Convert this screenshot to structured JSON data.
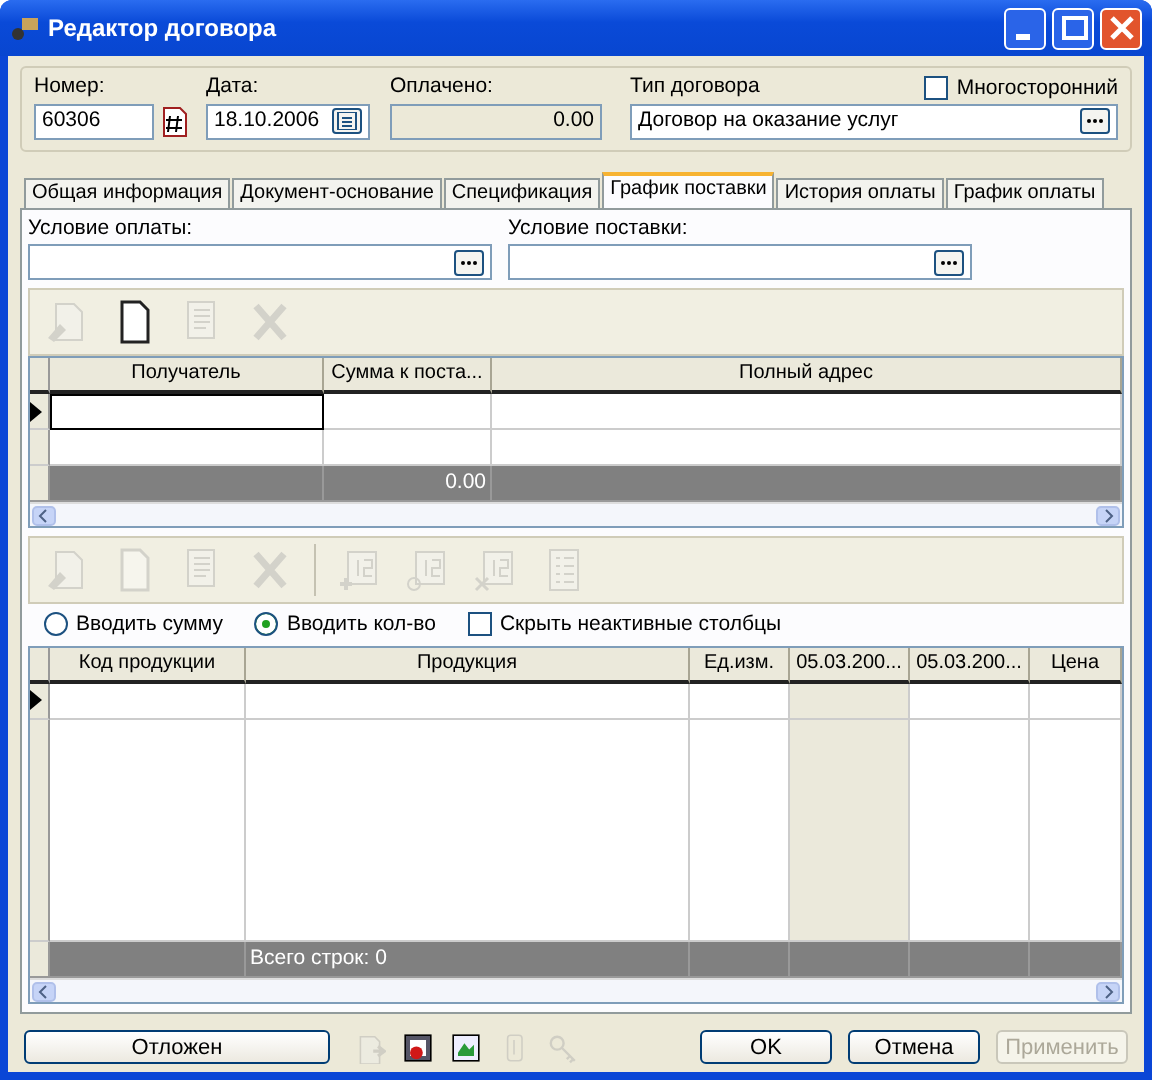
{
  "window": {
    "title": "Редактор договора"
  },
  "header": {
    "number": {
      "label": "Номер:",
      "value": "60306"
    },
    "date": {
      "label": "Дата:",
      "value": "18.10.2006"
    },
    "paid": {
      "label": "Оплачено:",
      "value": "0.00"
    },
    "contract_type": {
      "label": "Тип договора",
      "value": "Договор на оказание услуг"
    },
    "multilateral": {
      "label": "Многосторонний",
      "checked": false
    }
  },
  "tabs": [
    {
      "label": "Общая информация",
      "selected": false
    },
    {
      "label": "Документ-основание",
      "selected": false
    },
    {
      "label": "Спецификация",
      "selected": false
    },
    {
      "label": "График поставки",
      "selected": true
    },
    {
      "label": "История оплаты",
      "selected": false
    },
    {
      "label": "График оплаты",
      "selected": false
    }
  ],
  "conditions": [
    {
      "label": "Условие оплаты:"
    },
    {
      "label": "Условие поставки:"
    }
  ],
  "toolbar_1": [
    {
      "kind": "edit",
      "disabled": true
    },
    {
      "kind": "new",
      "disabled": false
    },
    {
      "kind": "copy",
      "disabled": true
    },
    {
      "kind": "delete",
      "disabled": true
    }
  ],
  "recipients_table": {
    "columns": [
      "Получатель",
      "Сумма к поста...",
      "Полный адрес"
    ],
    "total": "0.00"
  },
  "toolbar_2": [
    {
      "kind": "edit",
      "disabled": true
    },
    {
      "kind": "new",
      "disabled": true
    },
    {
      "kind": "copy",
      "disabled": true
    },
    {
      "kind": "delete",
      "disabled": true
    },
    {
      "kind": "date-add",
      "disabled": true
    },
    {
      "kind": "date-edit",
      "disabled": true
    },
    {
      "kind": "date-delete",
      "disabled": true
    },
    {
      "kind": "list",
      "disabled": true
    }
  ],
  "input_mode": [
    {
      "label": "Вводить сумму",
      "selected": false
    },
    {
      "label": "Вводить кол-во",
      "selected": true
    }
  ],
  "hide_inactive": {
    "label": "Скрыть неактивные столбцы",
    "checked": false
  },
  "products_table": {
    "columns": [
      {
        "label": "Код продукции",
        "highlighted": false
      },
      {
        "label": "Продукция",
        "highlighted": false
      },
      {
        "label": "Ед.изм.",
        "highlighted": false
      },
      {
        "label": "05.03.200...",
        "highlighted": true
      },
      {
        "label": "05.03.200...",
        "highlighted": false
      },
      {
        "label": "Цена",
        "highlighted": false
      }
    ],
    "footer": "Всего строк: 0"
  },
  "bottom": {
    "postpone": "Отложен",
    "icons": [
      {
        "kind": "export",
        "disabled": true
      },
      {
        "kind": "report",
        "disabled": false
      },
      {
        "kind": "import",
        "disabled": false
      },
      {
        "kind": "attach",
        "disabled": true
      },
      {
        "kind": "key",
        "disabled": true
      }
    ],
    "buttons": [
      {
        "label": "OK",
        "disabled": false
      },
      {
        "label": "Отмена",
        "disabled": false
      },
      {
        "label": "Применить",
        "disabled": true
      }
    ]
  }
}
